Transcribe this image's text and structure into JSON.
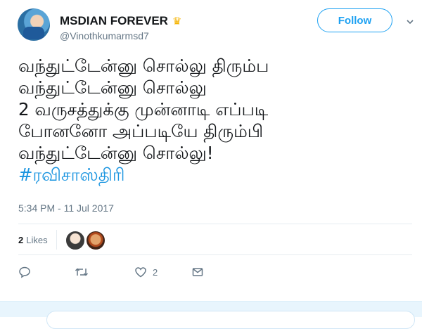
{
  "user": {
    "display_name": "MSDIAN FOREVER",
    "handle": "@Vinothkumarmsd7",
    "badge_icon": "crown-icon",
    "avatar_icon": "profile-avatar"
  },
  "follow": {
    "label": "Follow"
  },
  "tweet": {
    "lines": [
      "வந்துட்டேன்னு சொல்லு திரும்ப",
      "வந்துட்டேன்னு சொல்லு",
      "2 வருசத்துக்கு முன்னாடி எப்படி",
      "போனனோ அப்படியே திரும்பி",
      "வந்துட்டேன்னு சொல்லு!"
    ],
    "hashtag": "#ரவிசாஸ்திரி",
    "timestamp": "5:34 PM - 11 Jul 2017"
  },
  "stats": {
    "likes_count": "2",
    "likes_label": "Likes"
  },
  "actions": {
    "reply_icon": "reply-icon",
    "retweet_icon": "retweet-icon",
    "like_icon": "heart-icon",
    "like_count": "2",
    "dm_icon": "envelope-icon"
  },
  "colors": {
    "accent": "#1da1f2",
    "hashtag": "#1b95e0",
    "text": "#14171a",
    "muted": "#657786",
    "reply_bg": "#e8f5fd"
  }
}
